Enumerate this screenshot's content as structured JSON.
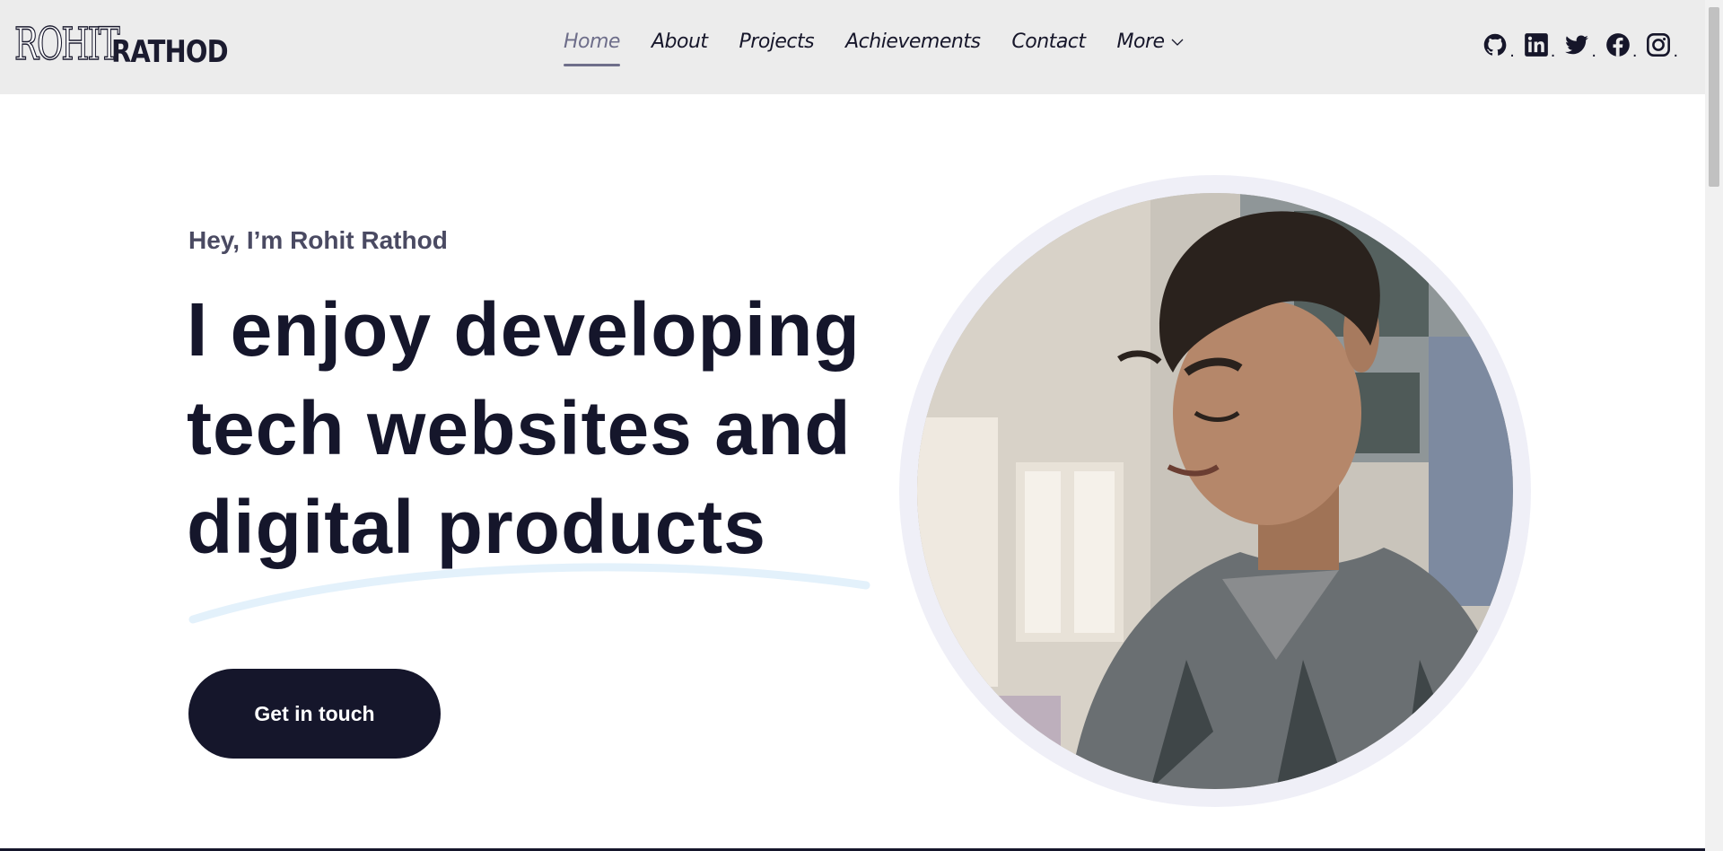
{
  "header": {
    "logo": {
      "first": "ROHIT",
      "last": "RATHOD"
    },
    "nav": [
      {
        "label": "Home",
        "active": true
      },
      {
        "label": "About"
      },
      {
        "label": "Projects"
      },
      {
        "label": "Achievements"
      },
      {
        "label": "Contact"
      },
      {
        "label": "More"
      }
    ],
    "socials": [
      {
        "icon": "github-icon",
        "sep": "."
      },
      {
        "icon": "linkedin-icon",
        "sep": "."
      },
      {
        "icon": "twitter-icon",
        "sep": "."
      },
      {
        "icon": "facebook-icon",
        "sep": "."
      },
      {
        "icon": "instagram-icon",
        "sep": "."
      }
    ]
  },
  "hero": {
    "greeting": "Hey, I’m Rohit Rathod",
    "headline_line1": "I enjoy developing",
    "headline_line2": "tech websites and",
    "headline_line3": "digital products",
    "cta_label": "Get in touch",
    "photo_icon": "profile-photo"
  },
  "colors": {
    "header_bg": "#ececec",
    "primary_dark": "#15162b",
    "active_nav": "#6e6e8a",
    "ring": "#efeff7",
    "underline": "#e3f1fb"
  }
}
